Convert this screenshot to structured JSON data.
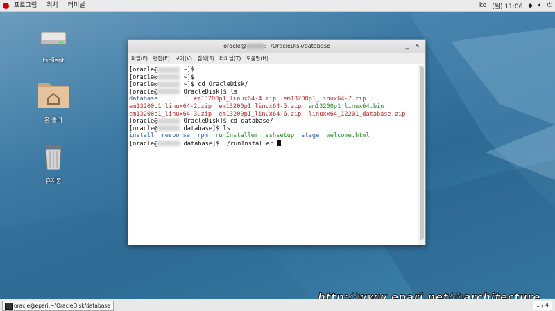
{
  "topbar": {
    "menu": [
      "프로그램",
      "위치",
      "터미널"
    ],
    "lang": "ko",
    "clock": "(월) 11:06",
    "icons": [
      "redhat-logo-icon",
      "network-icon",
      "volume-icon",
      "power-icon"
    ]
  },
  "desktop_icons": [
    {
      "name": "tsclient",
      "icon": "drive-icon"
    },
    {
      "name": "홈 폴더",
      "icon": "home-folder-icon"
    },
    {
      "name": "휴지통",
      "icon": "trash-icon"
    }
  ],
  "window": {
    "title": "oracle@",
    "title_suffix": ":~/OracleDisk/database",
    "menu": [
      "파일(F)",
      "편집(E)",
      "보기(V)",
      "검색(S)",
      "터미널(T)",
      "도움말(H)"
    ]
  },
  "terminal": {
    "lines": [
      {
        "segs": [
          {
            "t": "[oracle@",
            "c": ""
          },
          {
            "blur": true
          },
          {
            "t": " ~]$",
            "c": ""
          }
        ]
      },
      {
        "segs": [
          {
            "t": "[oracle@",
            "c": ""
          },
          {
            "blur": true
          },
          {
            "t": " ~]$",
            "c": ""
          }
        ]
      },
      {
        "segs": [
          {
            "t": "[oracle@",
            "c": ""
          },
          {
            "blur": true
          },
          {
            "t": " ~]$ cd OracleDisk/",
            "c": ""
          }
        ]
      },
      {
        "segs": [
          {
            "t": "[oracle@",
            "c": ""
          },
          {
            "blur": true
          },
          {
            "t": " OracleDisk]$ ls",
            "c": ""
          }
        ]
      },
      {
        "segs": [
          {
            "t": "database          ",
            "c": "c-dir"
          },
          {
            "t": "em13200p1_linux64-4.zip  em13200p1_linux64-7.zip",
            "c": "c-zip"
          }
        ]
      },
      {
        "segs": [
          {
            "t": "em13200p1_linux64-2.zip  em13200p1_linux64-5.zip  ",
            "c": "c-zip"
          },
          {
            "t": "em13200p1_linux64.bin",
            "c": "c-grn"
          }
        ]
      },
      {
        "segs": [
          {
            "t": "em13200p1_linux64-3.zip  em13200p1_linux64-6.zip  linuxx64_12201_database.zip",
            "c": "c-zip"
          }
        ]
      },
      {
        "segs": [
          {
            "t": "[oracle@",
            "c": ""
          },
          {
            "blur": true
          },
          {
            "t": " OracleDisk]$ cd database/",
            "c": ""
          }
        ]
      },
      {
        "segs": [
          {
            "t": "[oracle@",
            "c": ""
          },
          {
            "blur": true
          },
          {
            "t": " database]$ ls",
            "c": ""
          }
        ]
      },
      {
        "segs": [
          {
            "t": "install  response  rpm  ",
            "c": "c-dir"
          },
          {
            "t": "runInstaller  sshsetup  ",
            "c": "c-grn"
          },
          {
            "t": "stage  ",
            "c": "c-dir"
          },
          {
            "t": "welcome.html",
            "c": "c-grn"
          }
        ]
      },
      {
        "segs": [
          {
            "t": "[oracle@",
            "c": ""
          },
          {
            "blur": true
          },
          {
            "t": " database]$ ./runInstaller ",
            "c": ""
          },
          {
            "cursor": true
          }
        ]
      }
    ]
  },
  "taskbar": {
    "task_label": "oracle@epari:~/OracleDisk/database",
    "pager": "1 / 4"
  },
  "watermark": "http://www.epari.net/@architecture"
}
